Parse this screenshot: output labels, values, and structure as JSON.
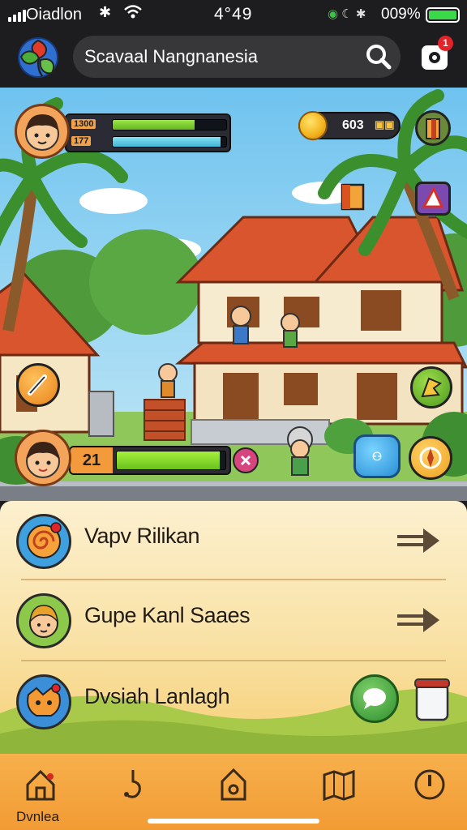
{
  "status_bar": {
    "carrier": "Oiadlon",
    "time": "4°49",
    "battery_percent": "009%",
    "battery_level": 1.0,
    "signal_strength": 4
  },
  "header": {
    "search_text": "Scavaal Nangnanesia",
    "notification_count": "1",
    "icons": {
      "logo": "game-logo-icon",
      "search": "search-icon",
      "settings": "settings-gear-icon"
    }
  },
  "hud": {
    "player_label_top": "1300",
    "player_label_bottom": "177",
    "health_fill": 0.72,
    "energy_fill": 0.95,
    "coins": "603",
    "level": "21",
    "level_progress": 0.95
  },
  "quests": [
    {
      "title": "Vapv Rilikan",
      "icon": "spiral-icon",
      "action": "arrow-right-icon"
    },
    {
      "title": "Gupe Kanl Saaes",
      "icon": "character-icon",
      "action": "arrow-right-icon"
    },
    {
      "title": "Dvsiah Lanlagh",
      "icon": "fox-icon",
      "action": "chat-icon"
    }
  ],
  "bottom_nav": {
    "label": "Dvnlea",
    "items": [
      "home-icon",
      "hook-icon",
      "house-tag-icon",
      "map-icon",
      "power-icon"
    ]
  },
  "colors": {
    "accent": "#f29b34",
    "health": "#7fd22b",
    "energy": "#55c8e8",
    "panel": "#fcefcb"
  }
}
